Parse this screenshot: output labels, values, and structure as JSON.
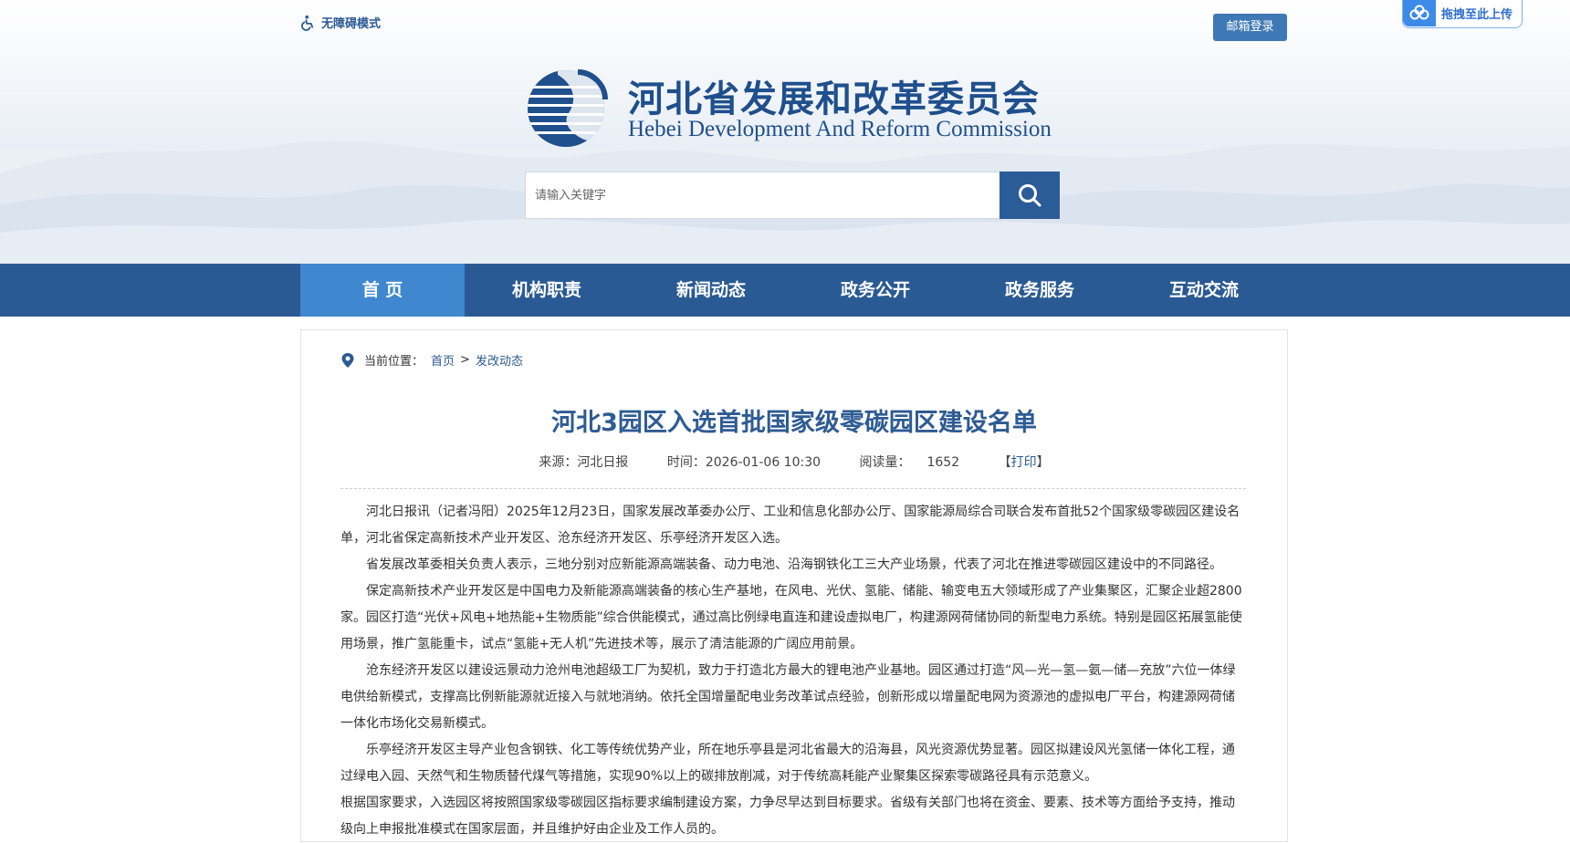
{
  "header": {
    "accessibility_label": "无障碍模式",
    "mail_login_label": "邮箱登录",
    "upload_label": "拖拽至此上传",
    "org_name_cn": "河北省发展和改革委员会",
    "org_name_en": "Hebei Development And Reform Commission",
    "search_placeholder": "请输入关键字"
  },
  "nav": {
    "items": [
      {
        "label": "首 页",
        "active": true
      },
      {
        "label": "机构职责"
      },
      {
        "label": "新闻动态"
      },
      {
        "label": "政务公开"
      },
      {
        "label": "政务服务"
      },
      {
        "label": "互动交流"
      }
    ]
  },
  "breadcrumb": {
    "prefix": "当前位置：",
    "items": [
      "首页",
      "发改动态"
    ],
    "separator": ">"
  },
  "article": {
    "title": "河北3园区入选首批国家级零碳园区建设名单",
    "source": "来源：河北日报",
    "time": "时间：2026-01-06 10:30",
    "views_label": "阅读量：",
    "views": "1652",
    "print_open": "【",
    "print_label": "打印",
    "print_close": "】",
    "paragraphs": [
      "河北日报讯（记者冯阳）2025年12月23日，国家发展改革委办公厅、工业和信息化部办公厅、国家能源局综合司联合发布首批52个国家级零碳园区建设名单，河北省保定高新技术产业开发区、沧东经济开发区、乐亭经济开发区入选。",
      "省发展改革委相关负责人表示，三地分别对应新能源高端装备、动力电池、沿海钢铁化工三大产业场景，代表了河北在推进零碳园区建设中的不同路径。",
      "保定高新技术产业开发区是中国电力及新能源高端装备的核心生产基地，在风电、光伏、氢能、储能、输变电五大领域形成了产业集聚区，汇聚企业超2800家。园区打造“光伏+风电+地热能+生物质能”综合供能模式，通过高比例绿电直连和建设虚拟电厂，构建源网荷储协同的新型电力系统。特别是园区拓展氢能使用场景，推广氢能重卡，试点“氢能+无人机”先进技术等，展示了清洁能源的广阔应用前景。",
      "沧东经济开发区以建设远景动力沧州电池超级工厂为契机，致力于打造北方最大的锂电池产业基地。园区通过打造“风—光—氢—氨—储—充放”六位一体绿电供给新模式，支撑高比例新能源就近接入与就地消纳。依托全国增量配电业务改革试点经验，创新形成以增量配电网为资源池的虚拟电厂平台，构建源网荷储一体化市场化交易新模式。",
      "乐亭经济开发区主导产业包含钢铁、化工等传统优势产业，所在地乐亭县是河北省最大的沿海县，风光资源优势显著。园区拟建设风光氢储一体化工程，通过绿电入园、天然气和生物质替代煤气等措施，实现90%以上的碳排放削减，对于传统高耗能产业聚集区探索零碳路径具有示范意义。",
      "根据国家要求，入选园区将按照国家级零碳园区指标要求编制建设方案，力争尽早达到目标要求。省级有关部门也将在资金、要素、技术等方面给予支持，推动级向上申报批准模式在国家层面，并且维护好由企业及工作人员的。"
    ]
  },
  "colors": {
    "nav_bg": "#2a5a93",
    "nav_active": "#3f87cf",
    "brand_blue": "#1f4f8c",
    "title_blue": "#2e5b93",
    "link_blue": "#2b5a93"
  },
  "icons": [
    "wheelchair-icon",
    "cloud-upload-icon",
    "emblem-logo",
    "search-icon",
    "location-pin-icon"
  ]
}
